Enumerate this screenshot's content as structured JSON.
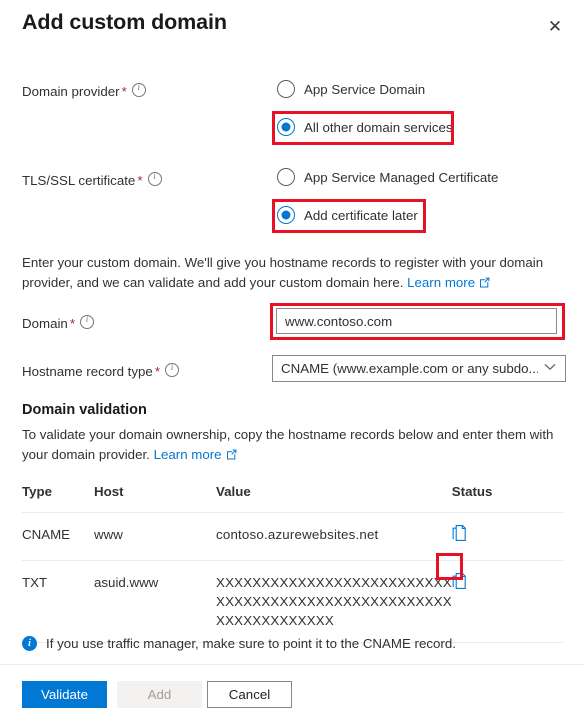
{
  "header": {
    "title": "Add custom domain",
    "close_icon": "close-icon",
    "close_glyph": "✕"
  },
  "fields": {
    "domain_provider": {
      "label": "Domain provider",
      "required_marker": "*",
      "info_icon": "info-icon",
      "options": [
        {
          "label": "App Service Domain",
          "selected": false,
          "highlighted": false
        },
        {
          "label": "All other domain services",
          "selected": true,
          "highlighted": true
        }
      ]
    },
    "tls_ssl_certificate": {
      "label": "TLS/SSL certificate",
      "required_marker": "*",
      "info_icon": "info-icon",
      "options": [
        {
          "label": "App Service Managed Certificate",
          "selected": false,
          "highlighted": false
        },
        {
          "label": "Add certificate later",
          "selected": true,
          "highlighted": true
        }
      ]
    },
    "domain": {
      "label": "Domain",
      "required_marker": "*",
      "value": "www.contoso.com",
      "placeholder": "",
      "highlighted": true
    },
    "hostname_record_type": {
      "label": "Hostname record type",
      "required_marker": "*",
      "selected_value": "CNAME (www.example.com or any subdo...",
      "chevron_icon": "chevron-down-icon",
      "chevron_glyph": "∨"
    }
  },
  "intro_text": {
    "line1": "Enter your custom domain. We'll give you hostname records to register with your domain",
    "line2": "provider, and we can validate and add your custom domain here.",
    "link_label": "Learn more",
    "link_icon": "external-link-icon"
  },
  "validation_section": {
    "title": "Domain validation",
    "description_line1": "To validate your domain ownership, copy the hostname records below and enter them with",
    "description_line2": "your domain provider.",
    "link_label": "Learn more",
    "link_icon": "external-link-icon"
  },
  "records_table": {
    "columns": [
      "Type",
      "Host",
      "Value",
      "Status"
    ],
    "rows": [
      {
        "type": "CNAME",
        "host": "www",
        "value_lines": [
          "contoso.azurewebsites.net"
        ],
        "copy_icon": "copy-icon",
        "copy_highlighted": false,
        "status": ""
      },
      {
        "type": "TXT",
        "host": "asuid.www",
        "value_lines": [
          "XXXXXXXXXXXXXXXXXXXXXXXXXX",
          "XXXXXXXXXXXXXXXXXXXXXXXXXX",
          "XXXXXXXXXXXXX"
        ],
        "copy_icon": "copy-icon",
        "copy_highlighted": true,
        "status": ""
      }
    ]
  },
  "info_bar": {
    "icon": "info-circle-icon",
    "icon_glyph": "i",
    "message": "If you use traffic manager, make sure to point it to the CNAME record."
  },
  "footer": {
    "validate_label": "Validate",
    "add_label": "Add",
    "cancel_label": "Cancel"
  },
  "colors": {
    "accent": "#0078d4",
    "highlight": "#e81123",
    "required": "#a4262c",
    "text": "#323130"
  }
}
